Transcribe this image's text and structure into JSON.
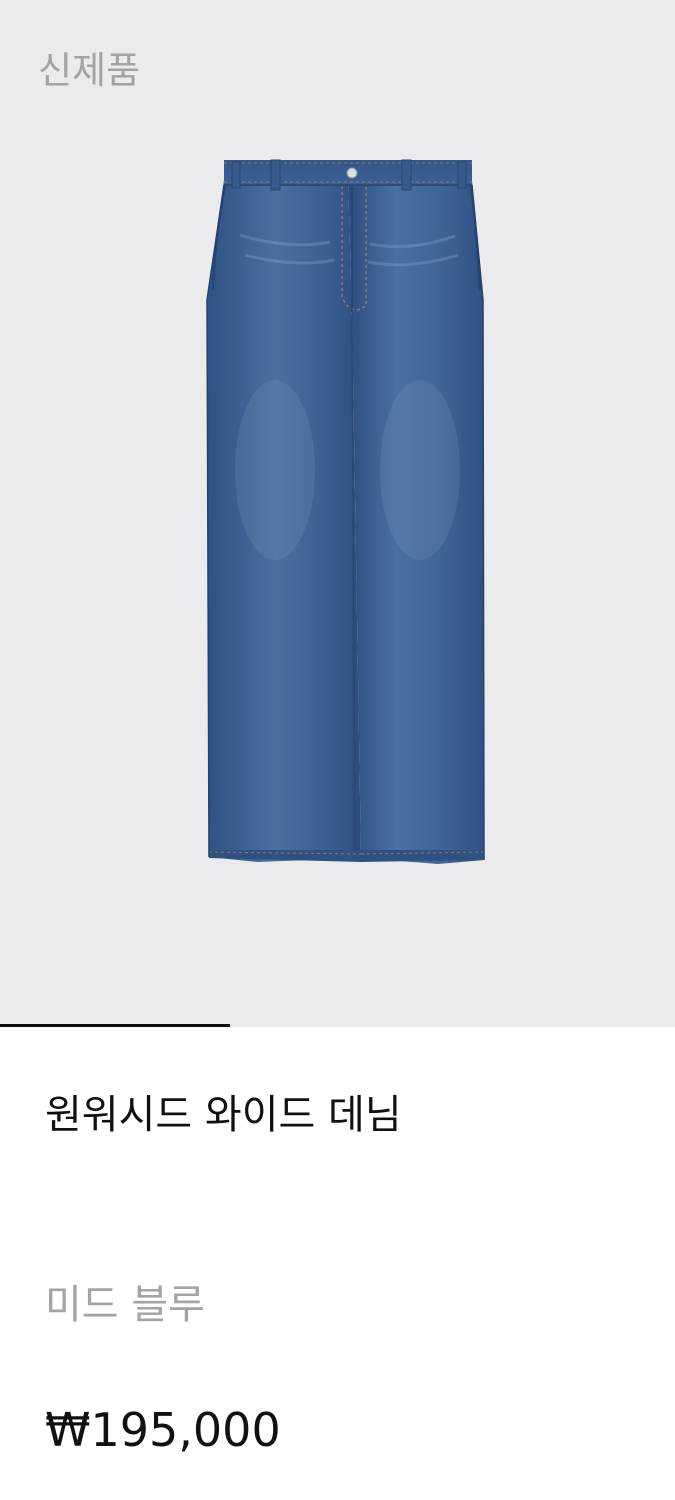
{
  "badge": "신제품",
  "carousel": {
    "progress": 0.34
  },
  "product": {
    "name": "원워시드 와이드 데님",
    "color_name": "미드 블루",
    "price": "₩195,000",
    "image_icon": "wide-leg-jeans-image"
  },
  "colors": {
    "image_bg": "#ebebed",
    "denim": "#3c5f8f",
    "text_primary": "#111111",
    "text_secondary": "#a3a3a5"
  }
}
